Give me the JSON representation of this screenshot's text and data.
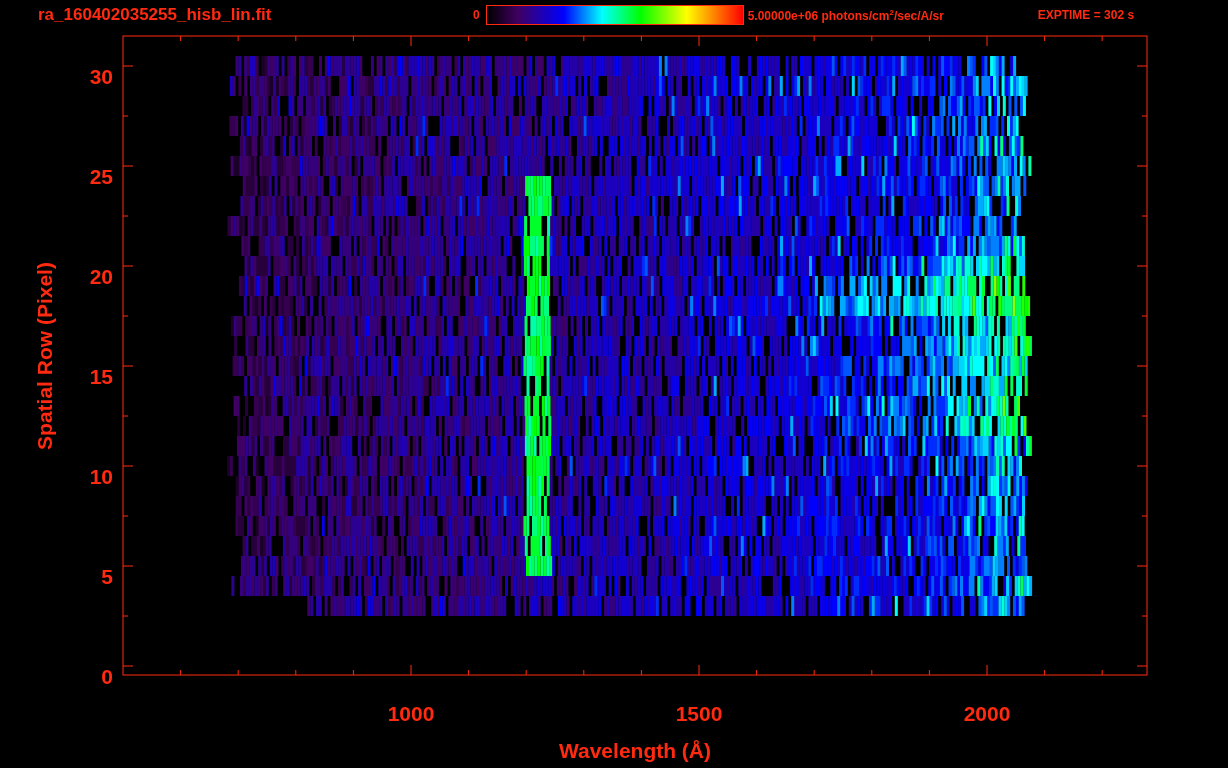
{
  "header": {
    "title": "ra_160402035255_hisb_lin.fit",
    "colorbar": {
      "min_label": "0",
      "max_label": "5.00000e+06 photons/cm$^{2}$/sec/A/sr"
    },
    "exposure": "EXPTIME = 302 s"
  },
  "plot": {
    "x_axis": {
      "title": "Wavelength (Å)",
      "tick_labels": [
        "1000",
        "1500",
        "2000"
      ]
    },
    "y_axis": {
      "title": "Spatial Row (Pixel)",
      "tick_labels": [
        "30",
        "25",
        "20",
        "15",
        "10",
        "5",
        "0"
      ]
    }
  }
}
